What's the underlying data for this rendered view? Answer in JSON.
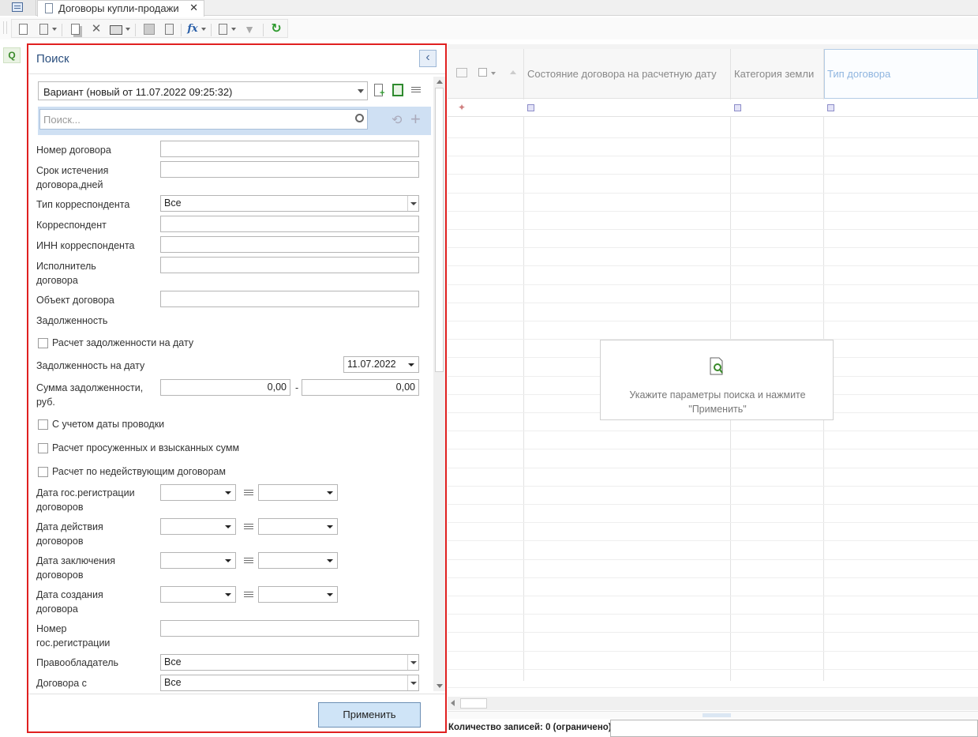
{
  "tabbar": {
    "active_tab": "Договоры купли-продажи",
    "close_glyph": "✕"
  },
  "colors": {
    "accent": "#2b4f7e",
    "highlight_border": "#e02020",
    "apply_button_bg": "#cfe4f7"
  },
  "toolbar": {
    "icons": [
      "new-icon",
      "edit-icon",
      "copy-icon",
      "delete-icon",
      "print-icon",
      "clone-icon",
      "approve-icon",
      "formula-icon",
      "document-icon",
      "filter-icon",
      "refresh-icon"
    ]
  },
  "panel": {
    "title": "Поиск",
    "variant": "Вариант (новый от 11.07.2022 09:25:32)",
    "search_placeholder": "Поиск...",
    "fields": {
      "contract_number": "Номер договора",
      "expiry_line1": "Срок истечения",
      "expiry_line2": "договора,дней",
      "correspondent_type": "Тип корреспондента",
      "correspondent_type_value": "Все",
      "correspondent": "Корреспондент",
      "inn": "ИНН корреспондента",
      "executor_line1": "Исполнитель",
      "executor_line2": "договора",
      "object": "Объект договора",
      "debt": "Задолженность",
      "debt_on_date_check": "Расчет задолженности на дату",
      "debt_on_date": "Задолженность на дату",
      "debt_on_date_value": "11.07.2022",
      "debt_sum_line1": "Сумма задолженности,",
      "debt_sum_line2": "руб.",
      "debt_sum_from": "0,00",
      "range_dash": "-",
      "debt_sum_to": "0,00",
      "posting_date_check": "С учетом даты проводки",
      "overdue_check": "Расчет просуженных и взысканных сумм",
      "inactive_check": "Расчет по недействующим договорам",
      "reg_date_line1": "Дата гос.регистрации",
      "reg_date_line2": "договоров",
      "action_date_line1": "Дата действия",
      "action_date_line2": "договоров",
      "conclusion_date_line1": "Дата заключения",
      "conclusion_date_line2": "договоров",
      "creation_date_line1": "Дата создания",
      "creation_date_line2": "договора",
      "reg_number_line1": "Номер",
      "reg_number_line2": "гос.регистрации",
      "right_holder": "Правообладатель",
      "right_holder_value": "Все",
      "contracts_with": "Договора с",
      "contracts_with_value": "Все"
    },
    "apply": "Применить"
  },
  "grid": {
    "columns": [
      "Состояние договора на расчетную дату",
      "Категория земли",
      "Тип договора"
    ],
    "empty_hint_line1": "Укажите параметры поиска и нажмите",
    "empty_hint_line2": "\"Применить\"",
    "status": "Количество записей: 0 (ограничено)"
  }
}
